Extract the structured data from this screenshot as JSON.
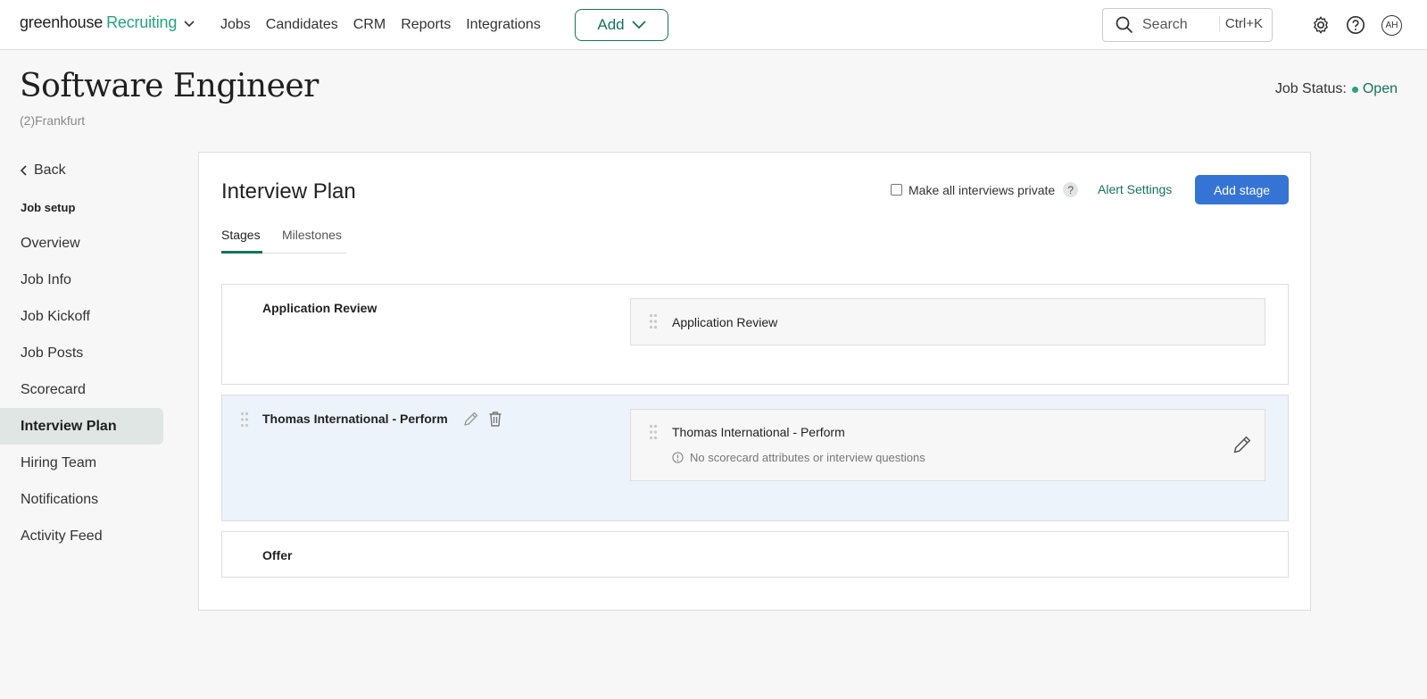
{
  "nav": {
    "logo_main": "greenhouse",
    "logo_product": "Recruiting",
    "links": [
      "Jobs",
      "Candidates",
      "CRM",
      "Reports",
      "Integrations"
    ],
    "add_label": "Add",
    "search_placeholder": "Search",
    "search_shortcut": "Ctrl+K",
    "avatar_initials": "AH"
  },
  "job": {
    "title": "Software Engineer",
    "location": "(2)Frankfurt",
    "status_label": "Job Status:",
    "status_value": "Open"
  },
  "sidebar": {
    "back_label": "Back",
    "section_heading": "Job setup",
    "items": [
      {
        "label": "Overview"
      },
      {
        "label": "Job Info"
      },
      {
        "label": "Job Kickoff"
      },
      {
        "label": "Job Posts"
      },
      {
        "label": "Scorecard"
      },
      {
        "label": "Interview Plan"
      },
      {
        "label": "Hiring Team"
      },
      {
        "label": "Notifications"
      },
      {
        "label": "Activity Feed"
      }
    ],
    "active_item": "Interview Plan"
  },
  "interview_plan": {
    "title": "Interview Plan",
    "private_checkbox_label": "Make all interviews private",
    "private_checked": false,
    "help_label": "?",
    "alert_settings_label": "Alert Settings",
    "add_stage_label": "Add stage",
    "tabs": [
      {
        "label": "Stages",
        "active": true
      },
      {
        "label": "Milestones",
        "active": false
      }
    ],
    "stages": [
      {
        "name": "Application Review",
        "interviews": [
          {
            "name": "Application Review"
          }
        ]
      },
      {
        "name": "Thomas International - Perform",
        "interviews": [
          {
            "name": "Thomas International - Perform",
            "note": "No scorecard attributes or interview questions"
          }
        ]
      },
      {
        "name": "Offer",
        "interviews": []
      }
    ]
  },
  "colors": {
    "brand_green": "#24a47f",
    "dark_green": "#15735a",
    "primary_blue": "#3574d4",
    "highlight_stage_bg": "#edf3fb"
  }
}
